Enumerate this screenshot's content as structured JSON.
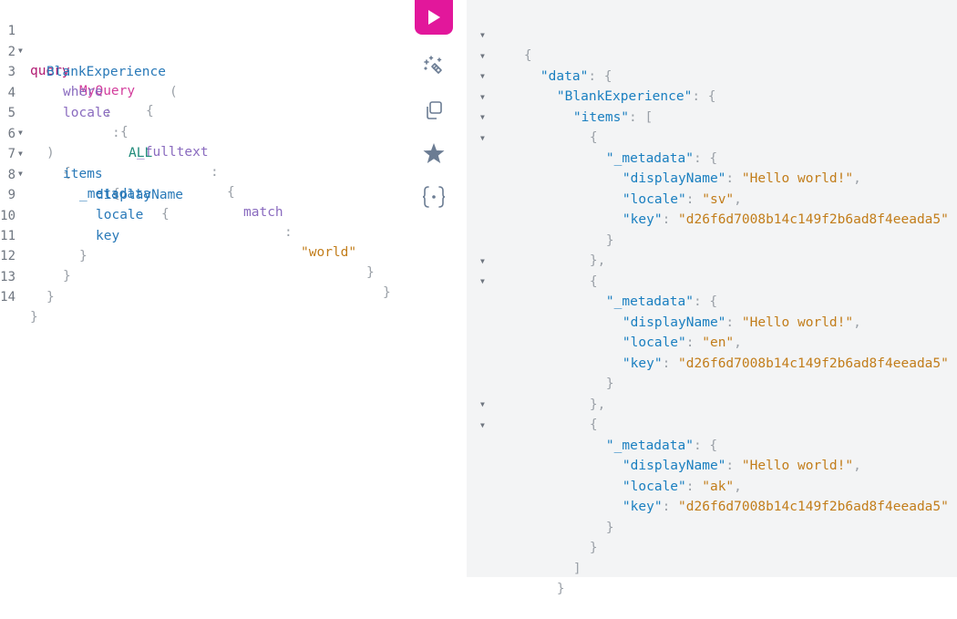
{
  "query_editor": {
    "line_numbers": [
      "1",
      "2",
      "3",
      "4",
      "5",
      "6",
      "7",
      "8",
      "9",
      "10",
      "11",
      "12",
      "13",
      "14"
    ],
    "tokens": {
      "query_kw": "query",
      "op_name": "MyQuery",
      "open_brace": "{",
      "close_brace": "}",
      "open_paren": "(",
      "close_paren": ")",
      "colon": ":",
      "blank_experience": "BlankExperience",
      "where_arg": "where",
      "fulltext_arg": "_fulltext",
      "match_arg": "match",
      "match_value": "\"world\"",
      "locale_arg": "locale",
      "locale_value": "ALL",
      "items": "items",
      "metadata": "_metadata",
      "display_name": "displayName",
      "locale_field": "locale",
      "key": "key"
    }
  },
  "toolbar": {
    "run_button": "run-execute-icon",
    "prettify_button": "magic-wand-icon",
    "copy_button": "copy-icon",
    "merge_button": "star-icon",
    "fragment_button": "brackets-icon"
  },
  "result": {
    "data_key": "\"data\"",
    "blank_experience_key": "\"BlankExperience\"",
    "items_key": "\"items\"",
    "metadata_key": "\"_metadata\"",
    "display_name_key": "\"displayName\"",
    "locale_key": "\"locale\"",
    "key_key": "\"key\"",
    "items": [
      {
        "displayName": "\"Hello world!\"",
        "locale": "\"sv\"",
        "key": "\"d26f6d7008b14c149f2b6ad8f4eeada5\""
      },
      {
        "displayName": "\"Hello world!\"",
        "locale": "\"en\"",
        "key": "\"d26f6d7008b14c149f2b6ad8f4eeada5\""
      },
      {
        "displayName": "\"Hello world!\"",
        "locale": "\"ak\"",
        "key": "\"d26f6d7008b14c149f2b6ad8f4eeada5\""
      }
    ]
  },
  "colors": {
    "run_button": "#e2179b",
    "keyword": "#b11a72",
    "field": "#2979b8",
    "string": "#c27d1a",
    "results_bg": "#f3f4f5"
  }
}
